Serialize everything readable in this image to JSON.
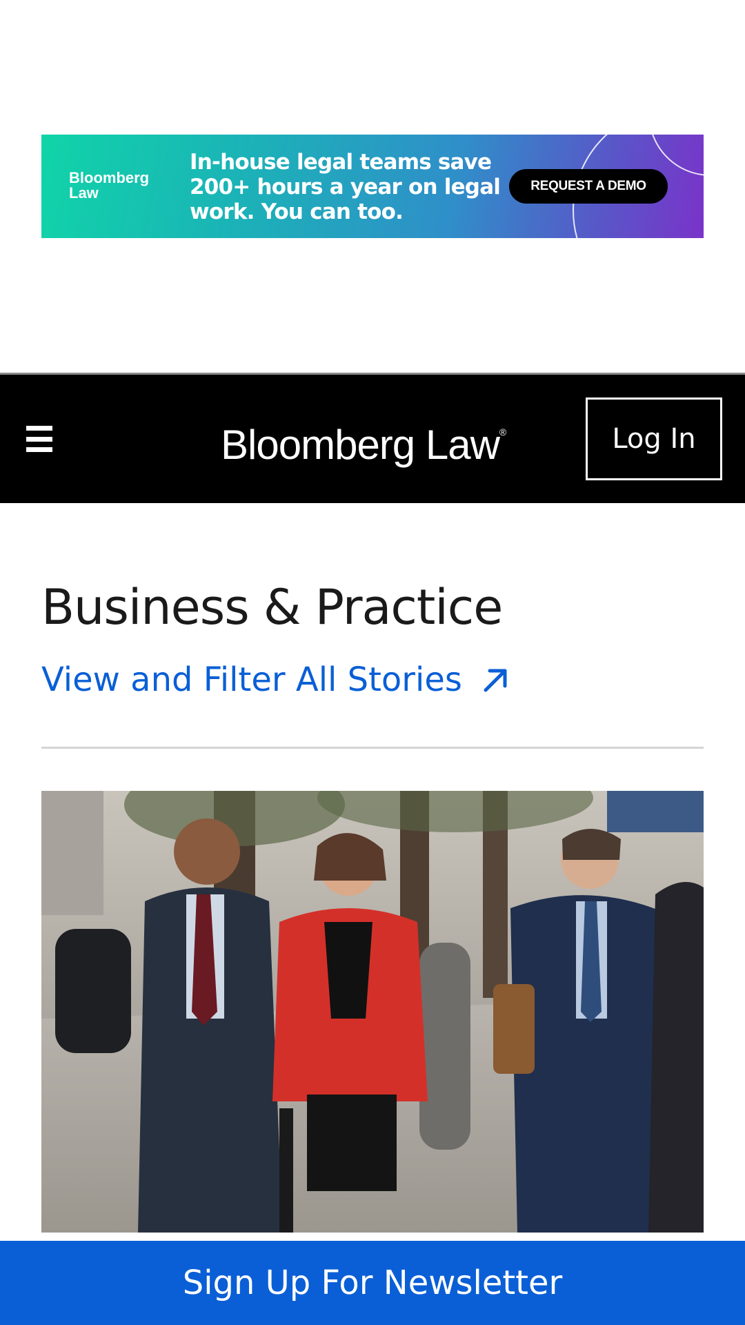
{
  "ad": {
    "logo_line1": "Bloomberg",
    "logo_line2": "Law",
    "headline_line1": "In-house legal teams save",
    "headline_line2": "200+ hours a year on legal",
    "headline_line3": "work. You can too.",
    "cta_label": "REQUEST A DEMO",
    "colors": {
      "start": "#10d4a8",
      "end": "#7a33c9"
    }
  },
  "header": {
    "menu_icon": "hamburger-menu-icon",
    "brand": "Bloomberg Law",
    "brand_mark": "®",
    "login_label": "Log In",
    "background": "#000000"
  },
  "section": {
    "title": "Business & Practice",
    "filter_link": "View and Filter All Stories",
    "filter_icon": "arrow-up-right-icon",
    "link_color": "#0a5fd6"
  },
  "story": {
    "image_alt_icon": "photo-icon"
  },
  "newsletter": {
    "label": "Sign Up For Newsletter",
    "background": "#0a5fd6"
  }
}
